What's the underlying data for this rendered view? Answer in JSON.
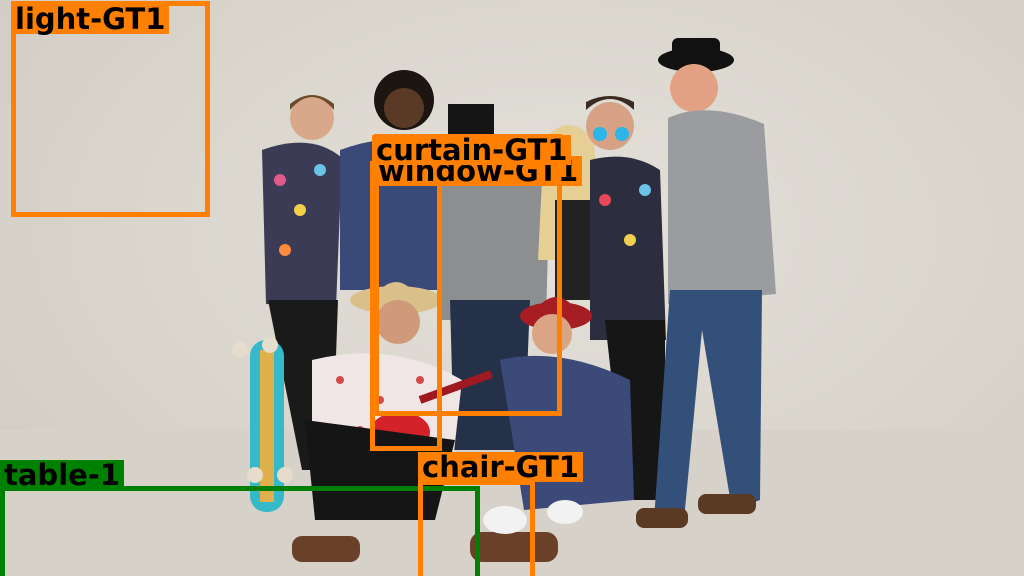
{
  "image": {
    "description_none": "",
    "background_color": "#d8d4cc"
  },
  "colors": {
    "ground_truth_box": "#ff8000",
    "detection_box": "#008000"
  },
  "labels": {
    "light": "light-GT1",
    "curtain": "curtain-GT1",
    "window": "window-GT1",
    "chair": "chair-GT1",
    "table": "table-1"
  }
}
